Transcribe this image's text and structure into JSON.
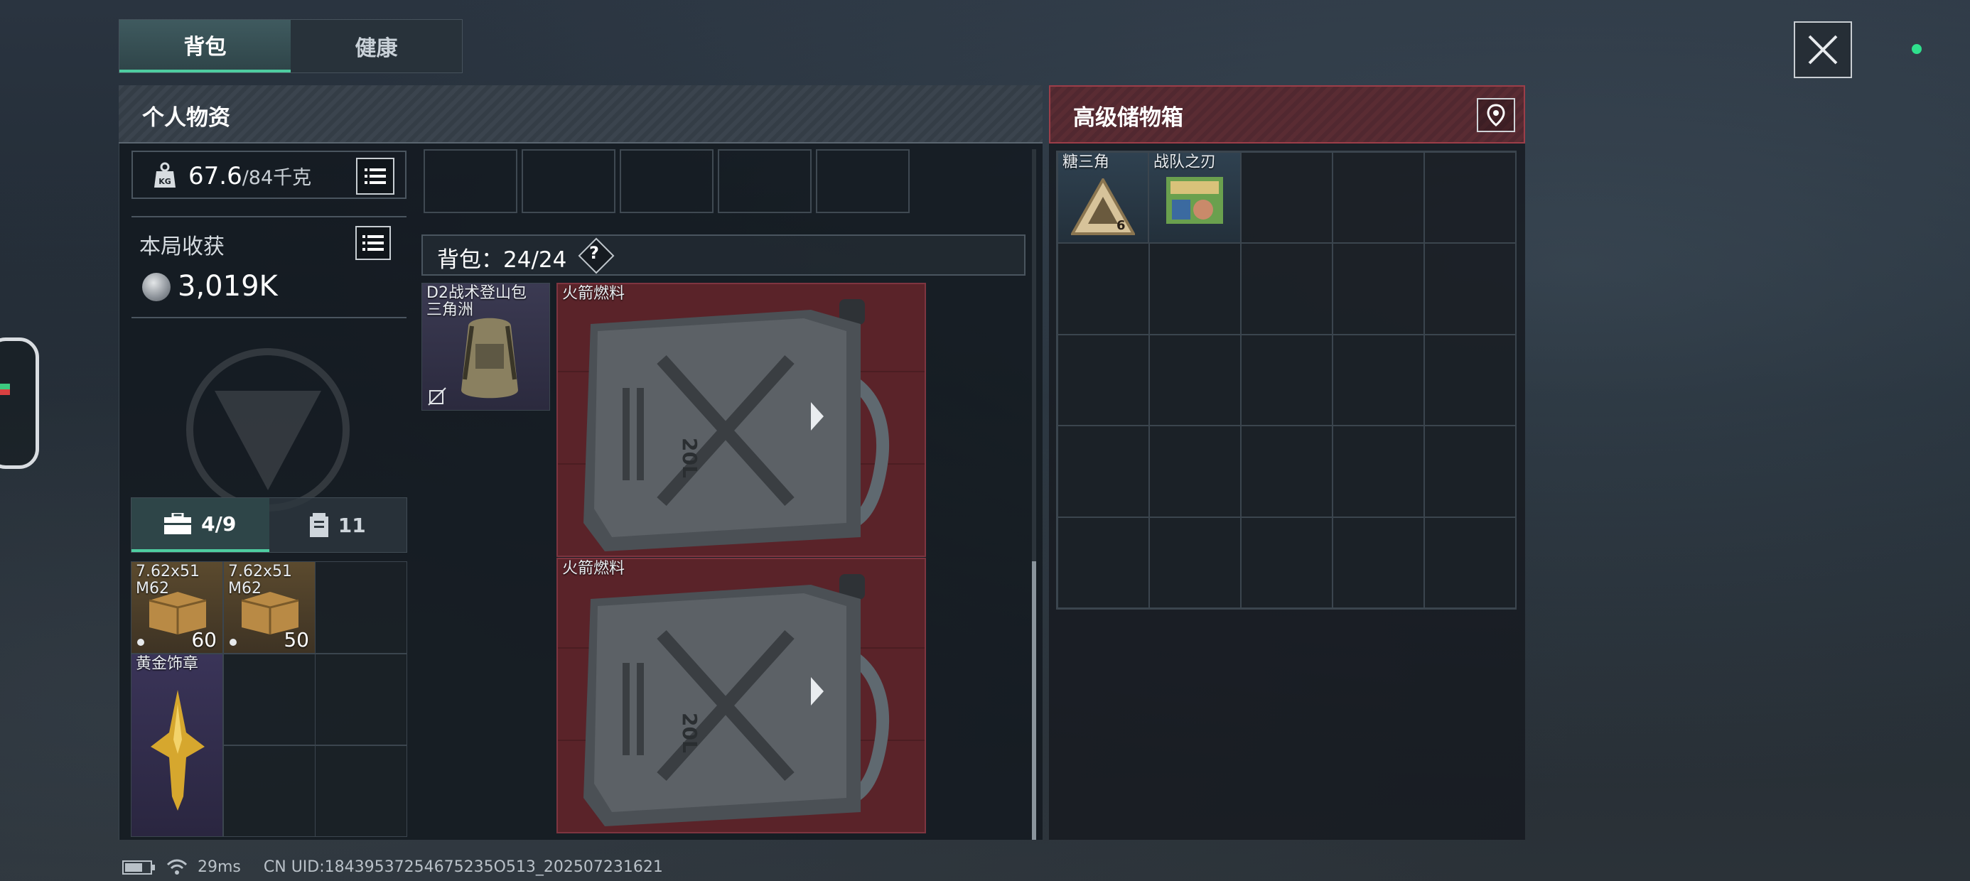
{
  "tabs": {
    "backpack": "背包",
    "health": "健康"
  },
  "personal": {
    "title": "个人物资",
    "weight_value": "67.6",
    "weight_max": "/84千克",
    "harvest_label": "本局收获",
    "harvest_value": "3,019K",
    "tab_items_count": "4/9",
    "tab_other_count": "11",
    "items": [
      {
        "label": "7.62x51\nM62",
        "count": "60"
      },
      {
        "label": "7.62x51\nM62",
        "count": "50"
      },
      {
        "label": "黄金饰章"
      }
    ]
  },
  "backpack": {
    "capacity_text": "背包：24/24",
    "help": "?",
    "bag_item": "D2战术登山包\n三角洲",
    "fuel_1": "火箭燃料",
    "fuel_2": "火箭燃料"
  },
  "storage": {
    "title": "高级储物箱",
    "items": [
      {
        "label": "糖三角"
      },
      {
        "label": "战队之刃"
      }
    ]
  },
  "footer": {
    "ping": "29ms",
    "uid": "CN UID:18439537254675235O513_202507231621"
  },
  "colors": {
    "accent_green": "#4ecda1",
    "storage_red": "#9c3e49",
    "status_dot": "#2fe08d"
  }
}
